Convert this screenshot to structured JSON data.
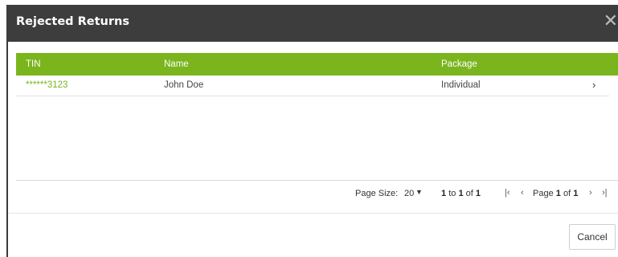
{
  "dialog": {
    "title": "Rejected Returns",
    "close_glyph": "✕"
  },
  "table": {
    "columns": [
      "TIN",
      "Name",
      "Package"
    ],
    "rows": [
      {
        "tin": "******3123",
        "name": "John Doe",
        "package": "Individual",
        "action_icon": "chevron-right-icon",
        "action_glyph": "›"
      }
    ]
  },
  "pager": {
    "page_size_label": "Page Size:",
    "page_size_value": "20",
    "caret": "▼",
    "range_from": "1",
    "range_to_word": "to",
    "range_to": "1",
    "range_of_word": "of",
    "range_total": "1",
    "first_glyph": "|‹",
    "prev_glyph": "‹",
    "page_word": "Page",
    "current_page": "1",
    "of_word": "of",
    "total_pages": "1",
    "next_glyph": "›",
    "last_glyph": "›|"
  },
  "footer": {
    "cancel_label": "Cancel"
  },
  "colors": {
    "accent": "#7ab51d",
    "header_bg": "#3d3d3d"
  }
}
